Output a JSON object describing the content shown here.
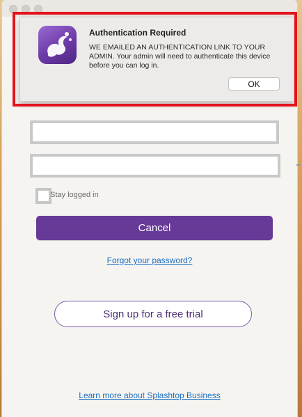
{
  "alert": {
    "title": "Authentication Required",
    "message": "WE EMAILED AN AUTHENTICATION LINK TO YOUR ADMIN. Your admin will need to authenticate this device before you can log in.",
    "ok_label": "OK",
    "icon": "splashtop-app-icon"
  },
  "login": {
    "username_value": "",
    "password_value": "",
    "stay_logged_in_label": "Stay logged in",
    "cancel_label": "Cancel",
    "forgot_password_label": "Forgot your password?",
    "free_trial_label": "Sign up for a free trial",
    "learn_more_label": "Learn more about Splashtop Business"
  },
  "colors": {
    "accent_purple": "#683a98",
    "link_blue": "#1b6ec2",
    "highlight_red": "#e3131c"
  }
}
